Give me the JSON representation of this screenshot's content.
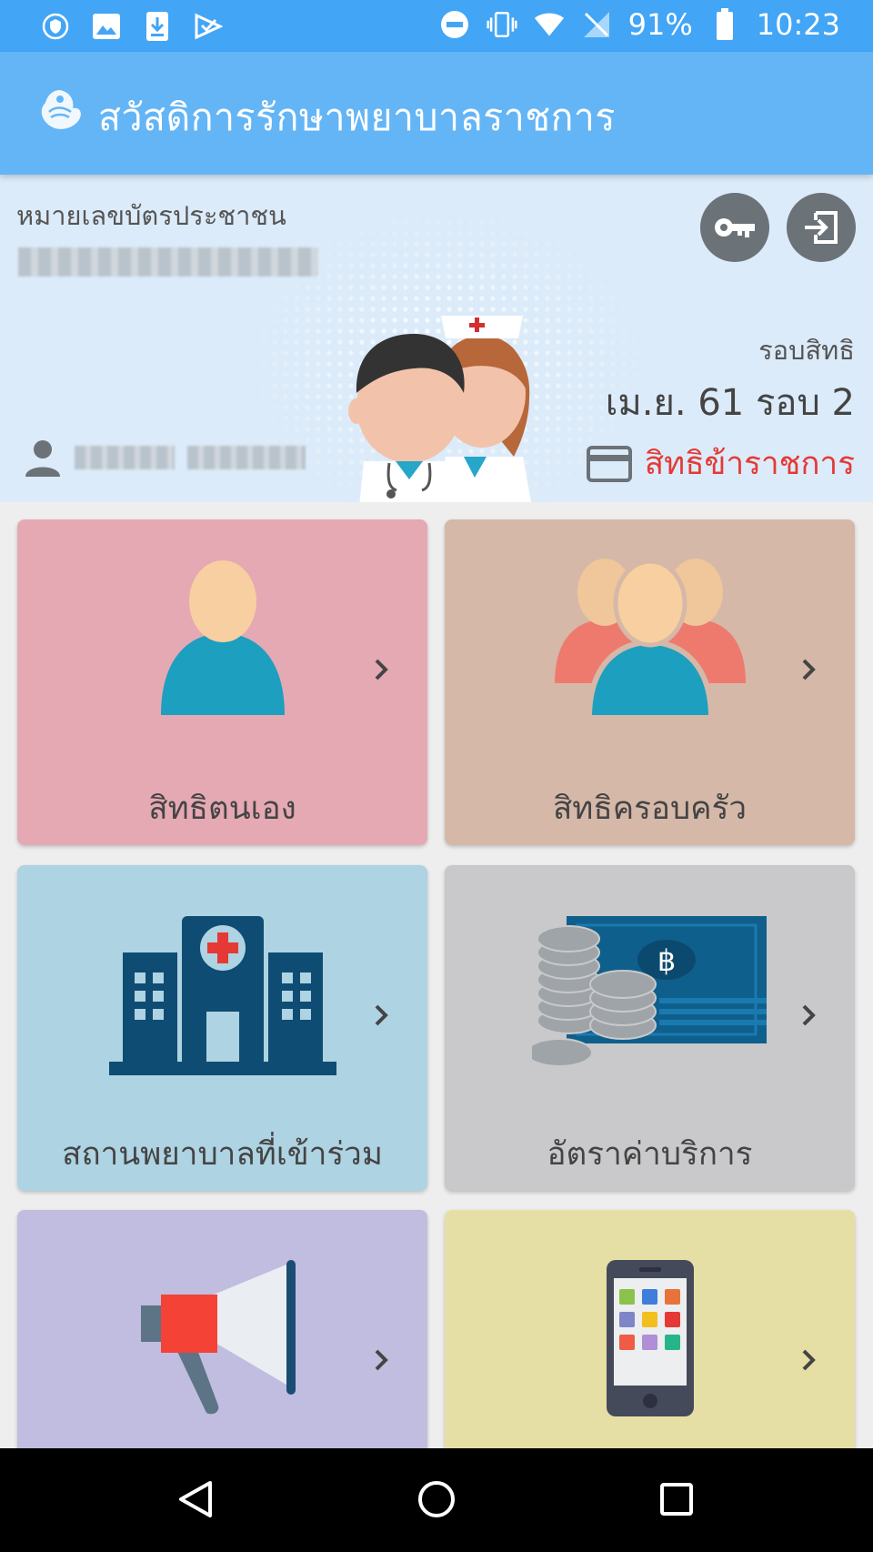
{
  "status_bar": {
    "battery": "91%",
    "time": "10:23"
  },
  "app_bar": {
    "title": "สวัสดิการรักษาพยาบาลราชการ"
  },
  "header": {
    "id_label": "หมายเลขบัตรประชาชน",
    "round_label": "รอบสิทธิ",
    "round_value": "เม.ย. 61 รอบ 2",
    "rights_text": "สิทธิข้าราชการ",
    "accent_red": "#e53935"
  },
  "tiles": [
    {
      "label": "สิทธิตนเอง",
      "color": "#e5a9b4",
      "icon": "person-icon"
    },
    {
      "label": "สิทธิครอบครัว",
      "color": "#d5b8a8",
      "icon": "family-icon"
    },
    {
      "label": "สถานพยาบาลที่เข้าร่วม",
      "color": "#aed3e2",
      "icon": "hospital-icon"
    },
    {
      "label": "อัตราค่าบริการ",
      "color": "#c9c9cb",
      "icon": "money-icon"
    },
    {
      "label": "",
      "color": "#c0bde0",
      "icon": "megaphone-icon"
    },
    {
      "label": "",
      "color": "#e6dfa5",
      "icon": "mobile-apps-icon"
    }
  ]
}
